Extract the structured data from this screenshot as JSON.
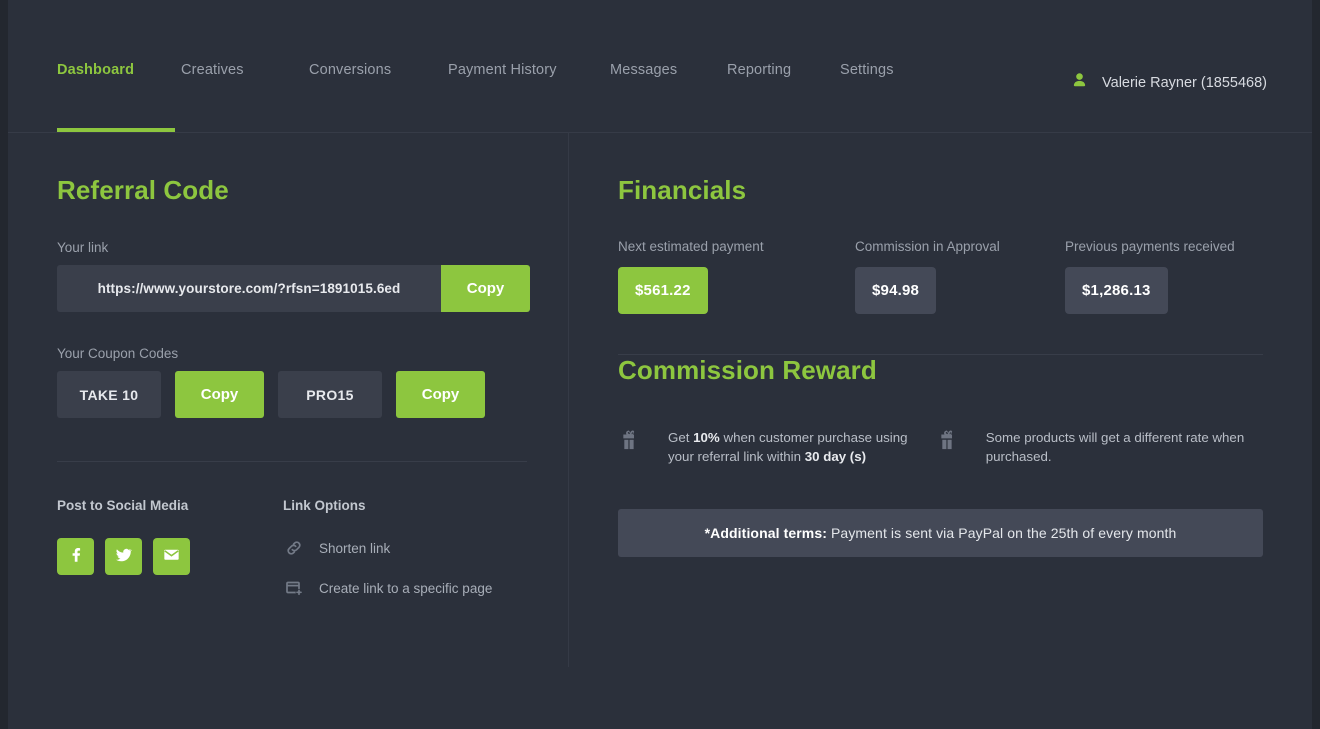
{
  "nav": {
    "items": [
      {
        "label": "Dashboard",
        "active": true
      },
      {
        "label": "Creatives",
        "active": false
      },
      {
        "label": "Conversions",
        "active": false
      },
      {
        "label": "Payment History",
        "active": false
      },
      {
        "label": "Messages",
        "active": false
      },
      {
        "label": "Reporting",
        "active": false
      },
      {
        "label": "Settings",
        "active": false
      }
    ],
    "user": {
      "icon": "user-icon",
      "name": "Valerie Rayner (1855468)"
    }
  },
  "referral": {
    "title": "Referral Code",
    "link_label": "Your link",
    "link_value": "https://www.yourstore.com/?rfsn=1891015.6ed",
    "link_copy_label": "Copy",
    "coupons_label": "Your Coupon Codes",
    "coupons": [
      {
        "code": "TAKE 10",
        "copy_label": "Copy"
      },
      {
        "code": "PRO15",
        "copy_label": "Copy"
      }
    ],
    "social": {
      "title": "Post to Social Media",
      "buttons": [
        {
          "icon": "facebook-icon",
          "name": "Facebook"
        },
        {
          "icon": "twitter-icon",
          "name": "Twitter"
        },
        {
          "icon": "email-icon",
          "name": "Email"
        }
      ]
    },
    "link_options": {
      "title": "Link Options",
      "items": [
        {
          "icon": "chain-link-icon",
          "label": "Shorten link"
        },
        {
          "icon": "new-page-link-icon",
          "label": "Create link to a specific page"
        }
      ]
    }
  },
  "financials": {
    "title": "Financials",
    "items": [
      {
        "label": "Next estimated payment",
        "value": "$561.22",
        "accent": true
      },
      {
        "label": "Commission in Approval",
        "value": "$94.98",
        "accent": false
      },
      {
        "label": "Previous payments received",
        "value": "$1,286.13",
        "accent": false
      }
    ]
  },
  "commission": {
    "title": "Commission Reward",
    "items": [
      {
        "icon": "gift-icon",
        "pre": "Get ",
        "b1": "10%",
        "mid": " when customer purchase using your referral link within ",
        "b2": "30 day (s)",
        "post": ""
      },
      {
        "icon": "gift-icon",
        "pre": "Some products will get a different rate when purchased.",
        "b1": "",
        "mid": "",
        "b2": "",
        "post": ""
      }
    ],
    "terms_prefix": "*Additional terms:",
    "terms_text": " Payment is sent via PayPal on the 25th of every month"
  },
  "colors": {
    "accent_green": "#8dc63f",
    "page_bg": "#2b303b",
    "panel": "#444957",
    "input_bg": "#3a3f4b"
  }
}
